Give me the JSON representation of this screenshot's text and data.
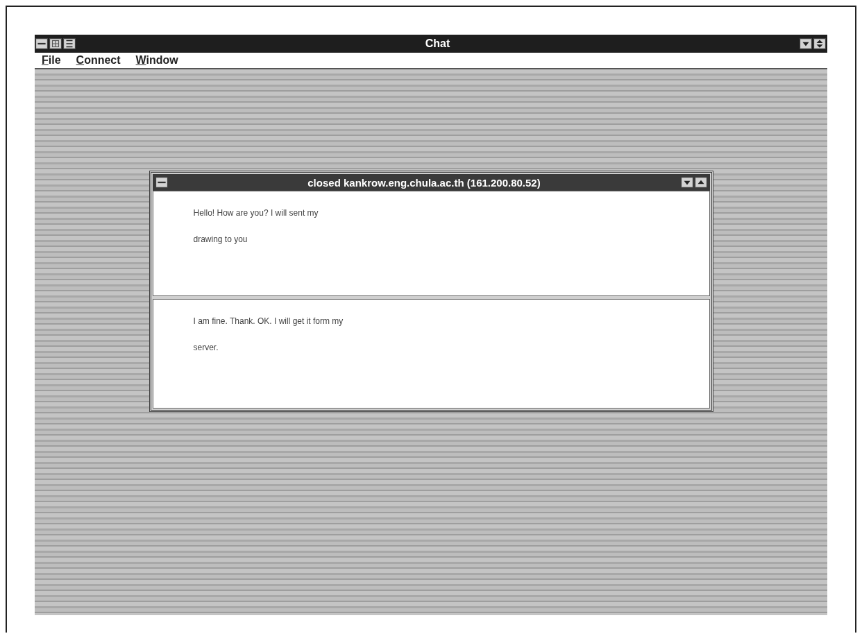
{
  "window": {
    "title": "Chat"
  },
  "menu": [
    {
      "label": "File"
    },
    {
      "label": "Connect"
    },
    {
      "label": "Window"
    }
  ],
  "chat_window": {
    "title": "closed kankrow.eng.chula.ac.th (161.200.80.52)",
    "panes": [
      {
        "lines": [
          "Hello! How are you? I will sent my",
          "drawing to you"
        ]
      },
      {
        "lines": [
          "I am fine. Thank. OK. I will get it form my",
          "server."
        ]
      }
    ]
  }
}
